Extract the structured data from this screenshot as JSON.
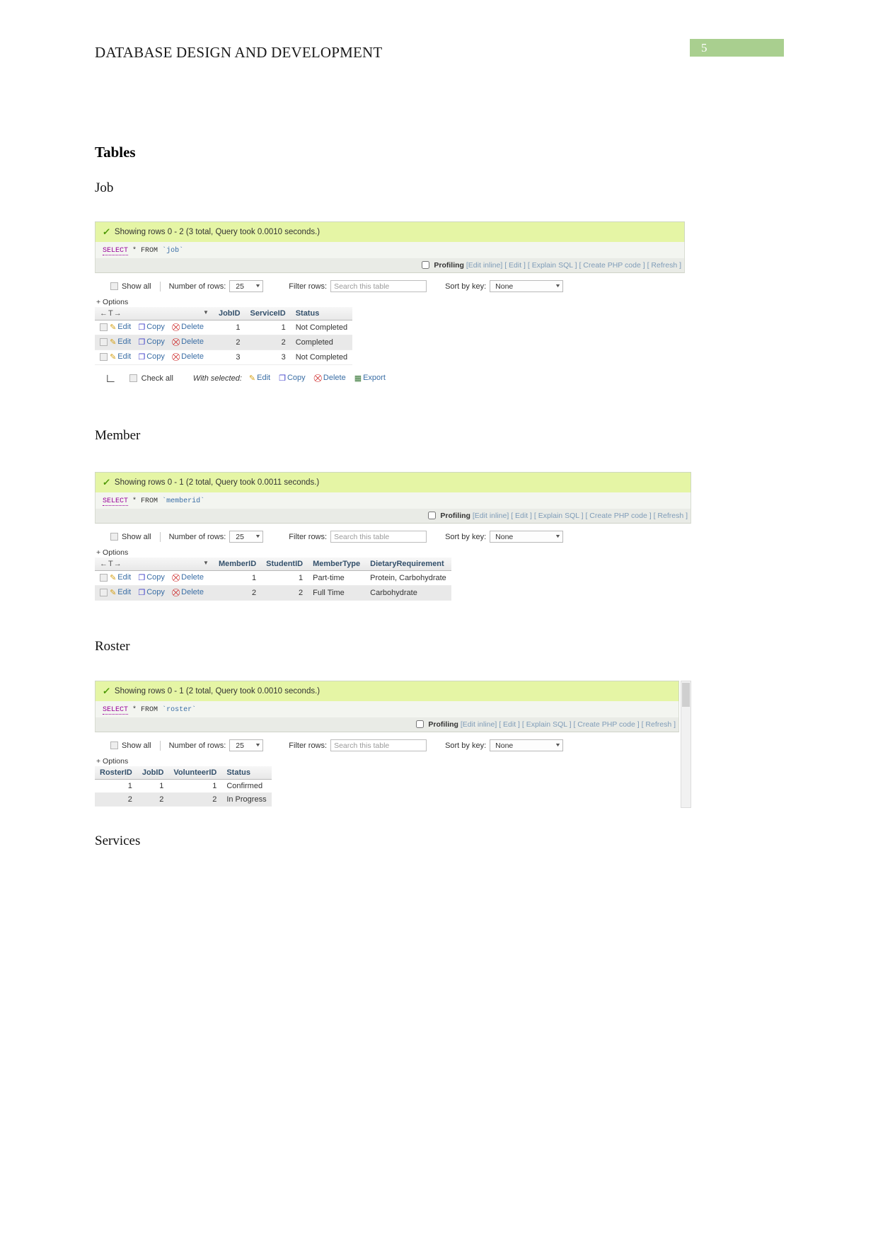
{
  "document": {
    "header_title": "DATABASE DESIGN AND DEVELOPMENT",
    "page_number": "5",
    "page_badge_color": "#a9cf8f",
    "headings": {
      "tables": "Tables",
      "job": "Job",
      "member": "Member",
      "roster": "Roster",
      "services": "Services"
    }
  },
  "common": {
    "profiling_label": "Profiling",
    "links": {
      "edit_inline": "[Edit inline]",
      "edit": "[ Edit ]",
      "explain_sql": "[ Explain SQL ]",
      "create_php": "[ Create PHP code ]",
      "refresh": "[ Refresh ]"
    },
    "controls": {
      "show_all": "Show all",
      "number_of_rows_label": "Number of rows:",
      "number_of_rows_value": "25",
      "filter_rows_label": "Filter rows:",
      "filter_rows_placeholder": "Search this table",
      "filter_rows_value": "",
      "sort_by_key_label": "Sort by key:",
      "sort_by_key_value": "None",
      "options_toggle": "+ Options"
    },
    "row_actions": {
      "edit": "Edit",
      "copy": "Copy",
      "delete": "Delete",
      "export": "Export"
    },
    "footer": {
      "check_all": "Check all",
      "with_selected": "With selected:"
    },
    "nav_arrows": "←T→"
  },
  "results": {
    "job": {
      "status_text": "Showing rows 0 - 2 (3 total, Query took 0.0010 seconds.)",
      "sql_keyword": "SELECT",
      "sql_mid": "* FROM",
      "sql_table": "`job`",
      "columns": [
        "JobID",
        "ServiceID",
        "Status"
      ],
      "rows": [
        {
          "JobID": "1",
          "ServiceID": "1",
          "Status": "Not Completed"
        },
        {
          "JobID": "2",
          "ServiceID": "2",
          "Status": "Completed"
        },
        {
          "JobID": "3",
          "ServiceID": "3",
          "Status": "Not Completed"
        }
      ]
    },
    "member": {
      "status_text": "Showing rows 0 - 1 (2 total, Query took 0.0011 seconds.)",
      "sql_keyword": "SELECT",
      "sql_mid": "* FROM",
      "sql_table": "`memberid`",
      "columns": [
        "MemberID",
        "StudentID",
        "MemberType",
        "DietaryRequirement"
      ],
      "rows": [
        {
          "MemberID": "1",
          "StudentID": "1",
          "MemberType": "Part-time",
          "DietaryRequirement": "Protein, Carbohydrate"
        },
        {
          "MemberID": "2",
          "StudentID": "2",
          "MemberType": "Full Time",
          "DietaryRequirement": "Carbohydrate"
        }
      ]
    },
    "roster": {
      "status_text": "Showing rows 0 - 1 (2 total, Query took 0.0010 seconds.)",
      "sql_keyword": "SELECT",
      "sql_mid": "* FROM",
      "sql_table": "`roster`",
      "columns": [
        "RosterID",
        "JobID",
        "VolunteerID",
        "Status"
      ],
      "rows": [
        {
          "RosterID": "1",
          "JobID": "1",
          "VolunteerID": "1",
          "Status": "Confirmed"
        },
        {
          "RosterID": "2",
          "JobID": "2",
          "VolunteerID": "2",
          "Status": "In Progress"
        }
      ]
    }
  }
}
